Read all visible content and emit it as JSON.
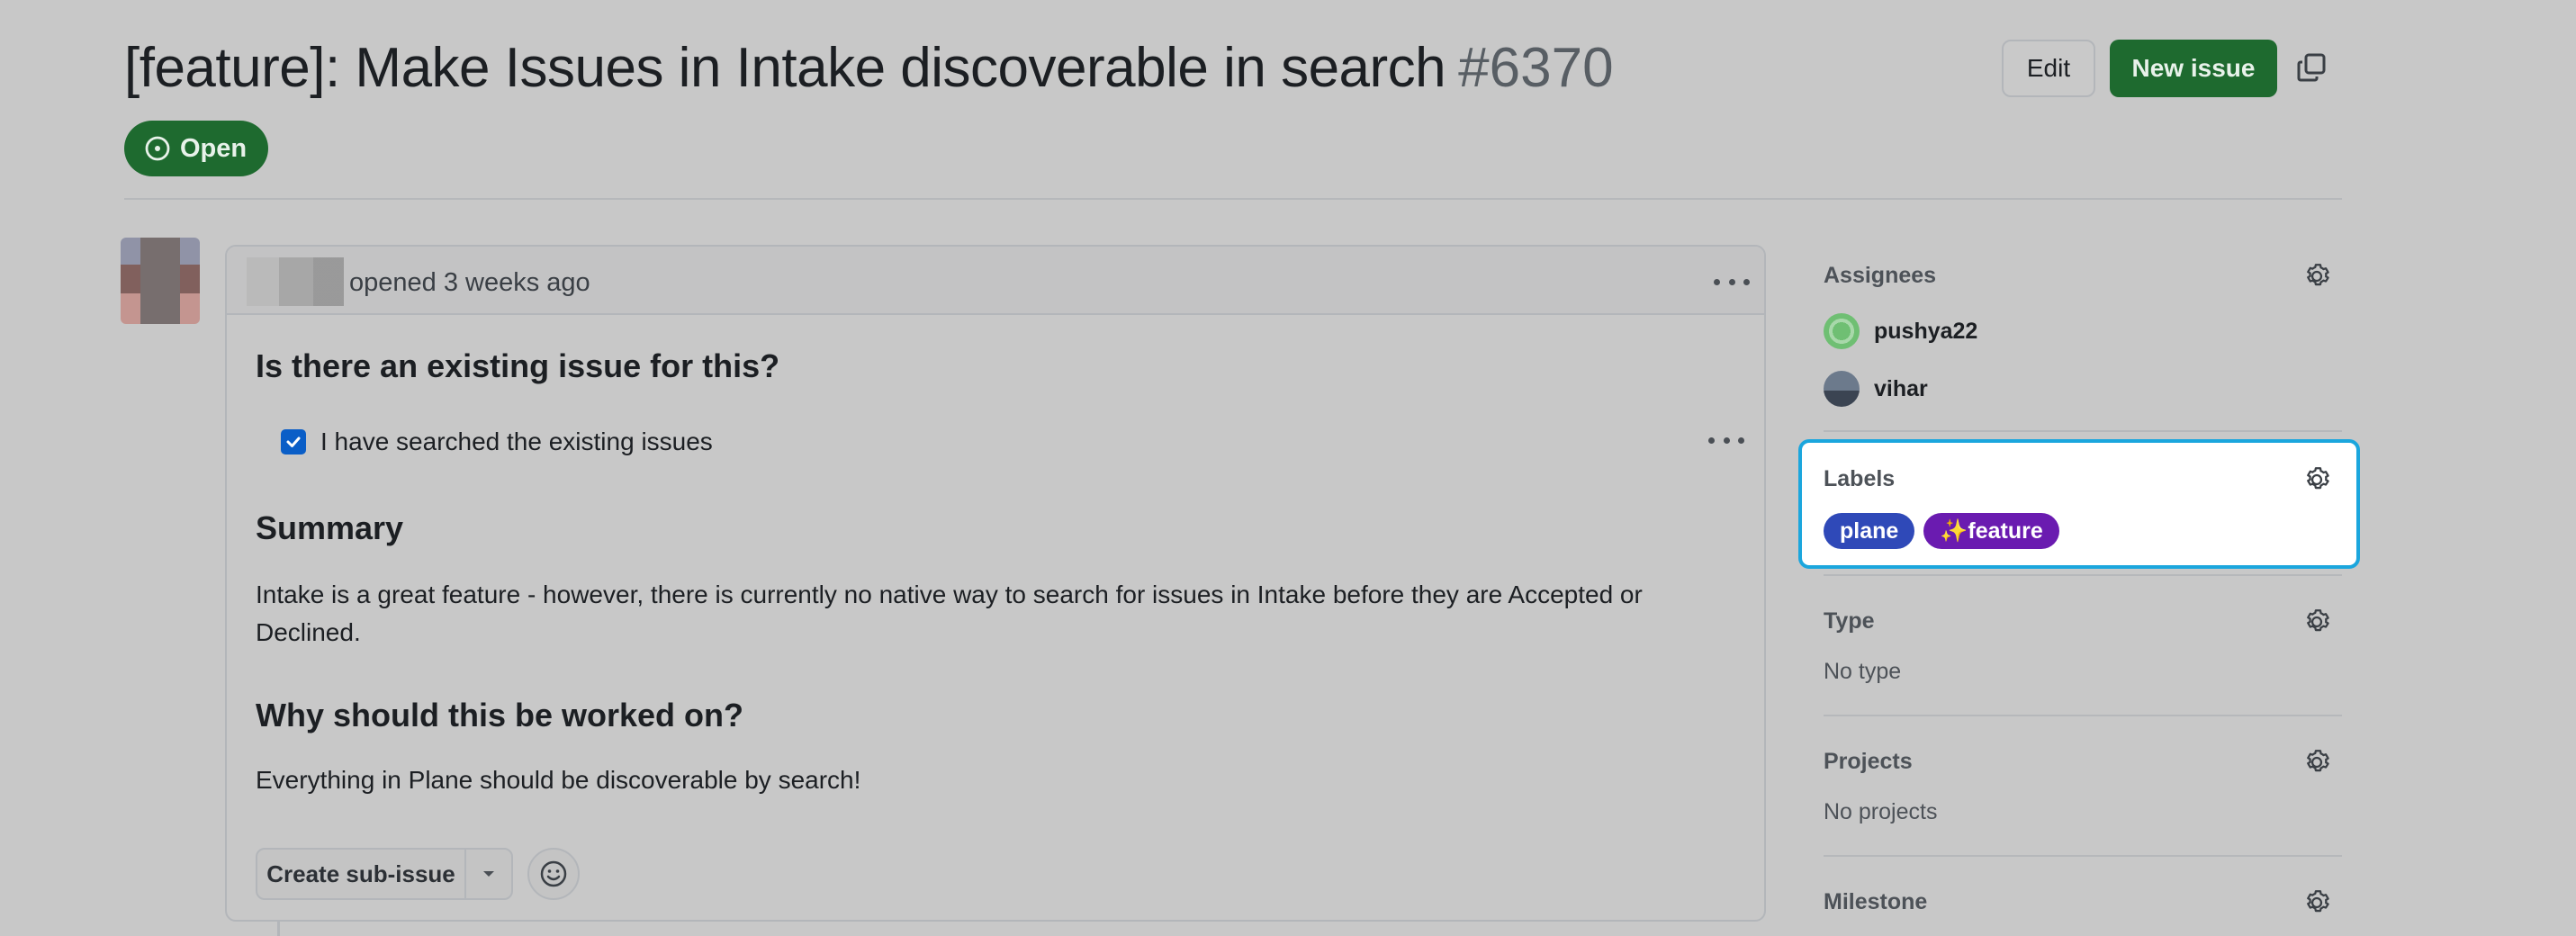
{
  "issue": {
    "title": "[feature]: Make Issues in Intake discoverable in search",
    "number": "#6370",
    "state": "Open"
  },
  "header_actions": {
    "edit_label": "Edit",
    "new_issue_label": "New issue",
    "copy_icon": "copy-icon"
  },
  "comment": {
    "meta": "opened 3 weeks ago",
    "q1_heading": "Is there an existing issue for this?",
    "checkbox_label": "I have searched the existing issues",
    "checkbox_checked": true,
    "summary_heading": "Summary",
    "summary_line1": "Intake is a great feature - however, there is currently no native way to search for issues in Intake before they are Accepted or",
    "summary_line2": "Declined.",
    "why_heading": "Why should this be worked on?",
    "why_text": "Everything in Plane should be discoverable by search!",
    "create_subissue_label": "Create sub-issue"
  },
  "sidebar": {
    "assignees_title": "Assignees",
    "assignees": [
      {
        "name": "pushya22"
      },
      {
        "name": "vihar"
      }
    ],
    "labels_title": "Labels",
    "labels": [
      {
        "name": "plane",
        "color": "#2f49b8"
      },
      {
        "name": "✨feature",
        "color": "#6a1bb0"
      }
    ],
    "type_title": "Type",
    "type_value": "No type",
    "projects_title": "Projects",
    "projects_value": "No projects",
    "milestone_title": "Milestone"
  },
  "colors": {
    "success_green": "#1e6a2f",
    "highlight_cyan": "#1ba6dd",
    "checkbox_blue": "#0a5ec7"
  }
}
